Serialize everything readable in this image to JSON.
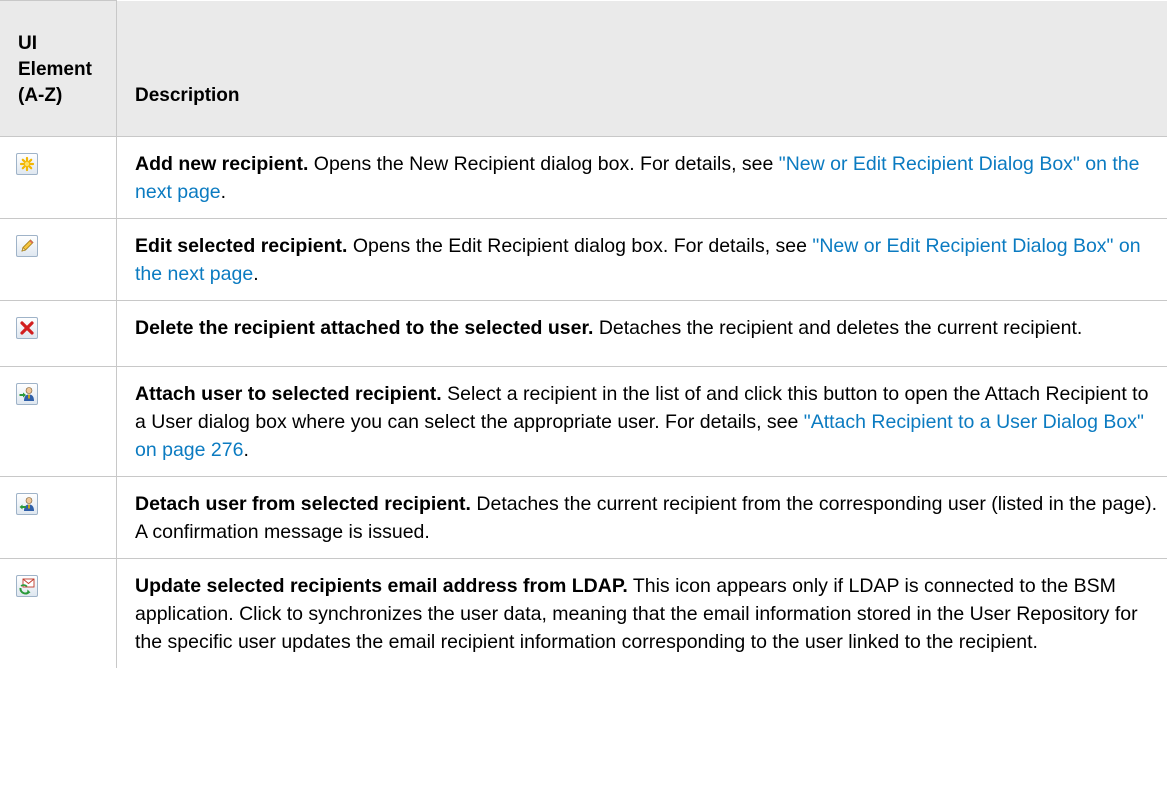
{
  "table": {
    "header": {
      "col1_line1": "UI",
      "col1_line2": "Element",
      "col1_line3": "(A-Z)",
      "col2": "Description"
    },
    "rows": [
      {
        "icon": "add-star-icon",
        "title": "Add new recipient.",
        "text": " Opens the New Recipient dialog box. For details, see ",
        "link": "\"New or Edit Recipient Dialog Box\" on the next page",
        "after": "."
      },
      {
        "icon": "pencil-edit-icon",
        "title": "Edit selected recipient.",
        "text": " Opens the Edit Recipient dialog box. For details, see ",
        "link": "\"New or Edit Recipient Dialog Box\" on the next page",
        "after": "."
      },
      {
        "icon": "delete-x-icon",
        "title": "Delete the recipient attached to the selected user.",
        "text": " Detaches the recipient and deletes the current recipient."
      },
      {
        "icon": "attach-user-icon",
        "title": "Attach user to selected recipient.",
        "text": " Select a recipient in the list of and click this button to open the Attach Recipient to a User dialog box where you can select the appropriate user. For details, see ",
        "link": "\"Attach Recipient to a User Dialog Box\" on page 276",
        "after": "."
      },
      {
        "icon": "detach-user-icon",
        "title": "Detach user from selected recipient.",
        "text": " Detaches the current recipient from the corresponding user (listed in the page). A confirmation message is issued."
      },
      {
        "icon": "ldap-email-sync-icon",
        "title": "Update selected recipients email address from LDAP.",
        "text": " This icon appears only if LDAP is connected to the BSM application. Click to synchronizes the user data, meaning that the email information stored in the User Repository for the specific user updates the email recipient information corresponding to the user linked to the recipient."
      }
    ]
  },
  "colors": {
    "link": "#0b7bc1",
    "header_bg": "#eaeaea",
    "border": "#c8c8c8"
  }
}
